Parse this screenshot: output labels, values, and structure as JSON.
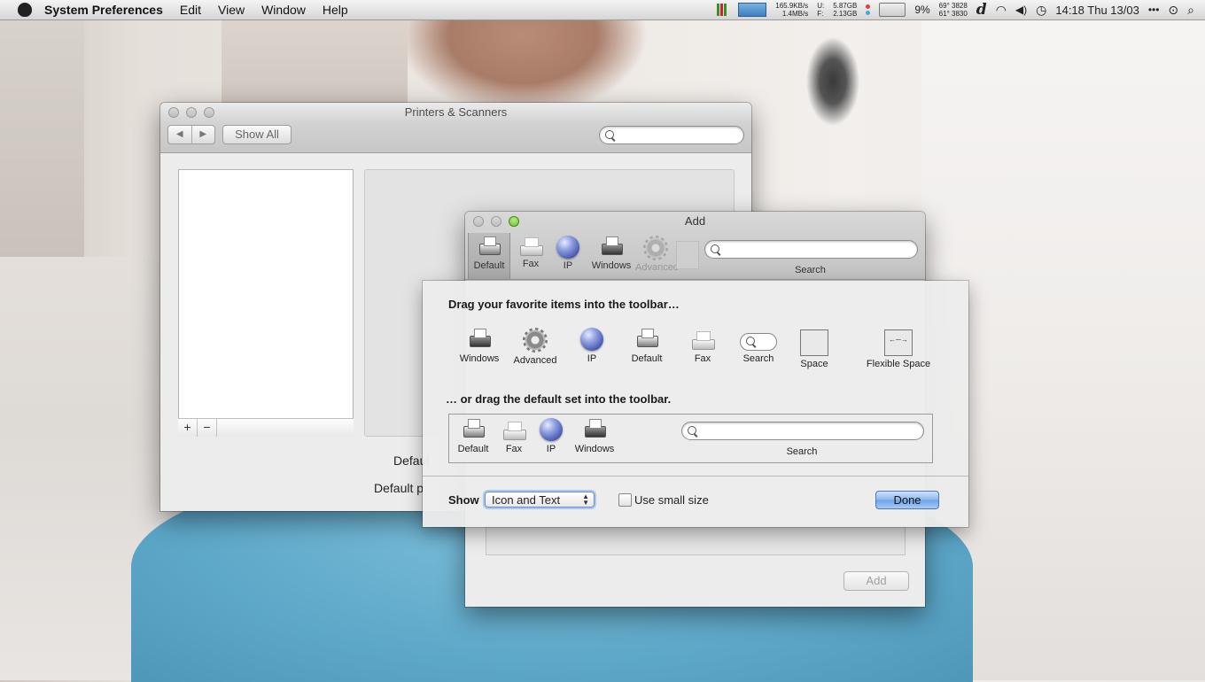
{
  "menubar": {
    "app_name": "System Preferences",
    "items": [
      "Edit",
      "View",
      "Window",
      "Help"
    ],
    "net_up": "165.9KB/s",
    "net_down": "1.4MB/s",
    "disk_u_label": "U:",
    "disk_f_label": "F:",
    "disk_u": "5.87GB",
    "disk_f": "2.13GB",
    "battery_percent": "9%",
    "temp_top": "69° 3828",
    "temp_bottom": "61° 3830",
    "d_glyph": "d",
    "clock": "14:18 Thu 13/03",
    "more": "•••"
  },
  "printers_window": {
    "title": "Printers & Scanners",
    "back": "◀",
    "forward": "▶",
    "show_all": "Show All",
    "add": "+",
    "remove": "−",
    "default_printer_label": "Defaul",
    "default_paper_label": "Default p"
  },
  "add_window": {
    "title": "Add",
    "toolbar": [
      {
        "label": "Default",
        "icon": "printer-search-icon"
      },
      {
        "label": "Fax",
        "icon": "fax-icon"
      },
      {
        "label": "IP",
        "icon": "globe-icon"
      },
      {
        "label": "Windows",
        "icon": "printer-icon"
      },
      {
        "label": "Advanced",
        "icon": "gear-icon"
      }
    ],
    "search_label": "Search",
    "add_button": "Add"
  },
  "customize_sheet": {
    "heading1": "Drag your favorite items into the toolbar…",
    "palette": [
      "Windows",
      "Advanced",
      "IP",
      "Default",
      "Fax",
      "Search",
      "Space",
      "Flexible Space"
    ],
    "heading2": "… or drag the default set into the toolbar.",
    "default_set": [
      "Default",
      "Fax",
      "IP",
      "Windows"
    ],
    "default_search": "Search",
    "show_label": "Show",
    "show_value": "Icon and Text",
    "small_size_label": "Use small size",
    "done": "Done"
  }
}
